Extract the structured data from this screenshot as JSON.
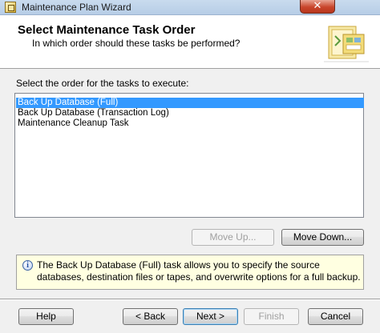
{
  "window": {
    "title": "Maintenance Plan Wizard",
    "icon": "wizard-app-icon",
    "close_icon": "close-icon"
  },
  "header": {
    "title": "Select Maintenance Task Order",
    "subtitle": "In which order should these tasks be performed?",
    "art": "wizard-banner-art"
  },
  "main": {
    "prompt": "Select the order for the tasks to execute:",
    "tasks": [
      {
        "label": "Back Up Database (Full)",
        "selected": true
      },
      {
        "label": "Back Up Database (Transaction Log)",
        "selected": false
      },
      {
        "label": "Maintenance Cleanup Task",
        "selected": false
      }
    ],
    "move_up_label": "Move Up...",
    "move_down_label": "Move Down..."
  },
  "info": {
    "icon": "info-icon",
    "text": "The Back Up Database (Full) task allows you to specify the source databases, destination files or tapes, and overwrite options for a full backup."
  },
  "footer": {
    "help_label": "Help",
    "back_label": "< Back",
    "next_label": "Next >",
    "finish_label": "Finish",
    "cancel_label": "Cancel"
  }
}
